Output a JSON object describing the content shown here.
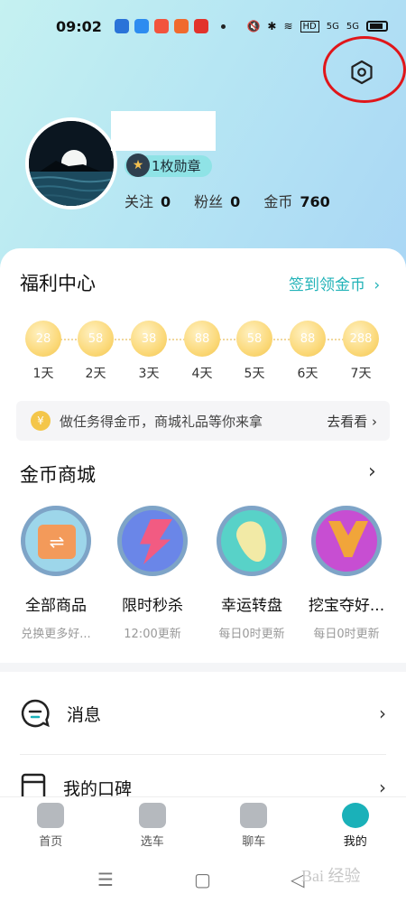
{
  "status_bar": {
    "time": "09:02",
    "network_labels": [
      "HD",
      "5G",
      "5G"
    ]
  },
  "profile": {
    "medal_label": "1枚勋章",
    "stats": [
      {
        "label": "关注",
        "value": "0"
      },
      {
        "label": "粉丝",
        "value": "0"
      },
      {
        "label": "金币",
        "value": "760"
      }
    ]
  },
  "welfare": {
    "title": "福利中心",
    "signin_link": "签到领金币",
    "rewards": [
      {
        "amount": "28",
        "day": "1天"
      },
      {
        "amount": "58",
        "day": "2天"
      },
      {
        "amount": "38",
        "day": "3天"
      },
      {
        "amount": "88",
        "day": "4天"
      },
      {
        "amount": "58",
        "day": "5天"
      },
      {
        "amount": "88",
        "day": "6天"
      },
      {
        "amount": "288",
        "day": "7天"
      }
    ],
    "task_text": "做任务得金币，商城礼品等你来拿",
    "task_link": "去看看",
    "coin_glyph": "¥"
  },
  "mall": {
    "title": "金币商城",
    "items": [
      {
        "name": "全部商品",
        "sub": "兑换更多好..."
      },
      {
        "name": "限时秒杀",
        "sub": "12:00更新"
      },
      {
        "name": "幸运转盘",
        "sub": "每日0时更新"
      },
      {
        "name": "挖宝夺好...",
        "sub": "每日0时更新"
      }
    ]
  },
  "menu": {
    "messages": "消息",
    "reputation": "我的口碑"
  },
  "tabs": [
    {
      "label": "首页"
    },
    {
      "label": "选车"
    },
    {
      "label": "聊车"
    },
    {
      "label": "我的"
    }
  ],
  "watermark": "Bai 经验",
  "colors": {
    "accent": "#22b3b8",
    "annotation_red": "#e0161a"
  }
}
